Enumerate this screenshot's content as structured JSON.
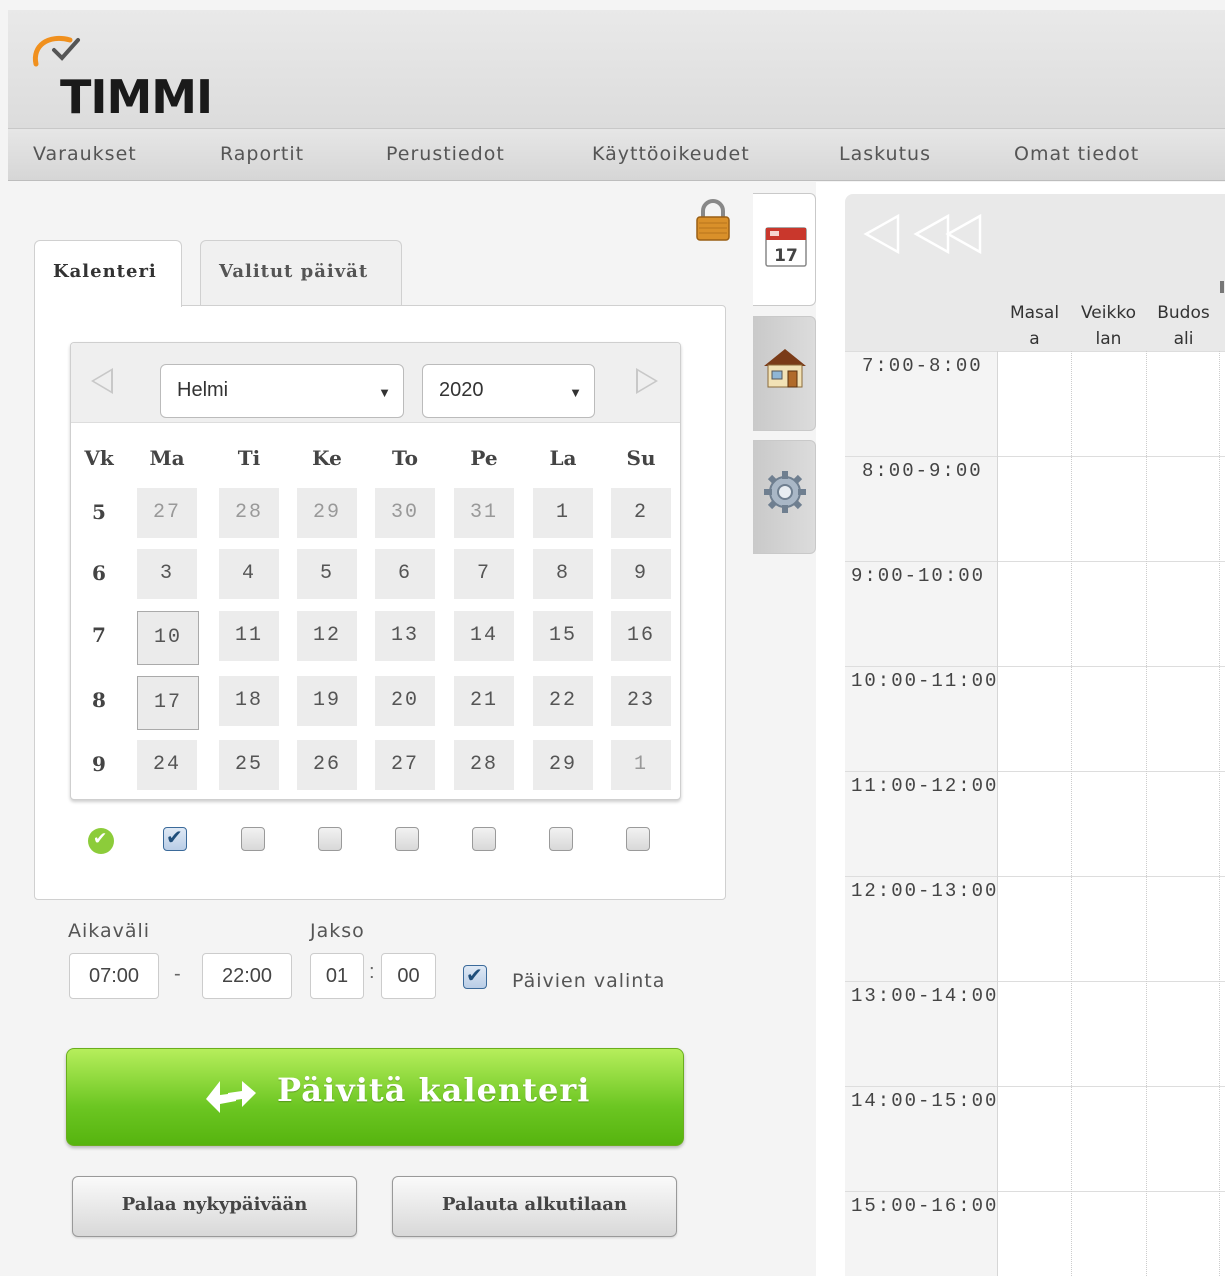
{
  "app": {
    "logo_text": "TIMMI"
  },
  "nav": [
    "Varaukset",
    "Raportit",
    "Perustiedot",
    "Käyttöoikeudet",
    "Laskutus",
    "Omat tiedot"
  ],
  "tabs": {
    "calendar": "Kalenteri",
    "selected_days": "Valitut päivät"
  },
  "calendar": {
    "month": "Helmi",
    "year": "2020",
    "weekday_headers": [
      "Vk",
      "Ma",
      "Ti",
      "Ke",
      "To",
      "Pe",
      "La",
      "Su"
    ],
    "weeks": [
      {
        "wk": "5",
        "days": [
          "27",
          "28",
          "29",
          "30",
          "31",
          "1",
          "2"
        ]
      },
      {
        "wk": "6",
        "days": [
          "3",
          "4",
          "5",
          "6",
          "7",
          "8",
          "9"
        ]
      },
      {
        "wk": "7",
        "days": [
          "10",
          "11",
          "12",
          "13",
          "14",
          "15",
          "16"
        ]
      },
      {
        "wk": "8",
        "days": [
          "17",
          "18",
          "19",
          "20",
          "21",
          "22",
          "23"
        ]
      },
      {
        "wk": "9",
        "days": [
          "24",
          "25",
          "26",
          "27",
          "28",
          "29",
          "1"
        ]
      }
    ],
    "weekday_checked": [
      true,
      false,
      false,
      false,
      false,
      false,
      false
    ]
  },
  "time_range": {
    "interval_label": "Aikaväli",
    "start": "07:00",
    "separator": "-",
    "end": "22:00",
    "period_label": "Jakso",
    "period_hours": "01",
    "period_colon": ":",
    "period_minutes": "00",
    "day_selection_label": "Päivien valinta",
    "day_selection_checked": true
  },
  "buttons": {
    "update": "Päivitä kalenteri",
    "today": "Palaa nykypäivään",
    "reset": "Palauta alkutilaan"
  },
  "side_icons": [
    "calendar-icon",
    "house-icon",
    "gear-icon"
  ],
  "side_calendar_day": "17",
  "schedule": {
    "columns": [
      {
        "line1": "Masal",
        "line2": "a"
      },
      {
        "line1": "Veikko",
        "line2": "lan"
      },
      {
        "line1": "Budos",
        "line2": "ali"
      }
    ],
    "time_slots": [
      "7:00-8:00",
      "8:00-9:00",
      "9:00-10:00",
      "10:00-11:00",
      "11:00-12:00",
      "12:00-13:00",
      "13:00-14:00",
      "14:00-15:00",
      "15:00-16:00"
    ]
  },
  "colors": {
    "accent_green": "#6cc622",
    "logo_orange": "#f0901e"
  }
}
